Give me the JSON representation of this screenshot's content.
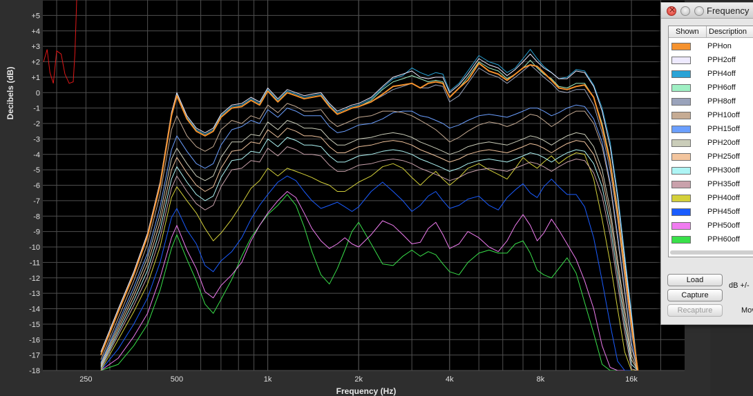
{
  "window": {
    "title": "Frequency",
    "table_headers": {
      "shown": "Shown",
      "description": "Description"
    },
    "buttons": {
      "load": "Load",
      "capture": "Capture",
      "recapture": "Recapture"
    },
    "db_label": "dB +/-",
    "mo_label": "Mov"
  },
  "colors": {
    "background": "#000000",
    "grid": "#505050",
    "frame": "#2e2e2e",
    "axis_text": "#e0e0e0"
  },
  "chart_data": {
    "type": "line",
    "title": "",
    "xlabel": "Frequency (Hz)",
    "ylabel": "Decibels (dB)",
    "xscale": "log",
    "xlim": [
      180,
      24000
    ],
    "ylim": [
      -18,
      6
    ],
    "grid": true,
    "legend": "side panel",
    "x_ticks": [
      {
        "value": 250,
        "label": "250"
      },
      {
        "value": 500,
        "label": "500"
      },
      {
        "value": 1000,
        "label": "1k"
      },
      {
        "value": 2000,
        "label": "2k"
      },
      {
        "value": 4000,
        "label": "4k"
      },
      {
        "value": 8000,
        "label": "8k"
      },
      {
        "value": 16000,
        "label": "16k"
      }
    ],
    "y_ticks": [
      {
        "value": 5,
        "label": "+5"
      },
      {
        "value": 4,
        "label": "+4"
      },
      {
        "value": 3,
        "label": "+3"
      },
      {
        "value": 2,
        "label": "+2"
      },
      {
        "value": 1,
        "label": "+1"
      },
      {
        "value": 0,
        "label": "0"
      },
      {
        "value": -1,
        "label": "-1"
      },
      {
        "value": -2,
        "label": "-2"
      },
      {
        "value": -3,
        "label": "-3"
      },
      {
        "value": -4,
        "label": "-4"
      },
      {
        "value": -5,
        "label": "-5"
      },
      {
        "value": -6,
        "label": "-6"
      },
      {
        "value": -7,
        "label": "-7"
      },
      {
        "value": -8,
        "label": "-8"
      },
      {
        "value": -9,
        "label": "-9"
      },
      {
        "value": -10,
        "label": "-10"
      },
      {
        "value": -11,
        "label": "-11"
      },
      {
        "value": -12,
        "label": "-12"
      },
      {
        "value": -13,
        "label": "-13"
      },
      {
        "value": -14,
        "label": "-14"
      },
      {
        "value": -15,
        "label": "-15"
      },
      {
        "value": -16,
        "label": "-16"
      },
      {
        "value": -17,
        "label": "-17"
      },
      {
        "value": -18,
        "label": "-18"
      }
    ],
    "x": [
      280,
      320,
      360,
      400,
      440,
      480,
      500,
      540,
      580,
      620,
      660,
      700,
      760,
      820,
      880,
      940,
      1000,
      1080,
      1160,
      1240,
      1320,
      1400,
      1500,
      1600,
      1700,
      1800,
      1900,
      2000,
      2200,
      2400,
      2600,
      2800,
      3000,
      3200,
      3400,
      3600,
      3800,
      4000,
      4300,
      4600,
      5000,
      5400,
      5800,
      6200,
      6600,
      7000,
      7400,
      7800,
      8200,
      8700,
      9200,
      9800,
      10500,
      11200,
      12000,
      12800,
      13600,
      14400,
      15200,
      16000,
      16800
    ],
    "series": [
      {
        "name": "PPHon",
        "color": "#f5922e",
        "values": [
          -17,
          -14.2,
          -11.8,
          -9.3,
          -6,
          -1.5,
          -0.2,
          -1.7,
          -2.5,
          -2.8,
          -2.5,
          -1.6,
          -1,
          -0.9,
          -0.5,
          -0.8,
          0.1,
          -0.6,
          0,
          -0.2,
          -0.4,
          -0.3,
          -0.2,
          -0.9,
          -1.4,
          -1.2,
          -1,
          -0.9,
          -0.6,
          -0.1,
          0.4,
          0.5,
          0.6,
          0.3,
          0.6,
          0.7,
          0.6,
          -0.3,
          0.3,
          0.8,
          1.9,
          1.4,
          1.2,
          0.8,
          1.2,
          1.6,
          1.8,
          1.7,
          1.3,
          0.8,
          0.3,
          0.2,
          0.4,
          0.5,
          -0.3,
          -2.2,
          -4.5,
          -7.8,
          -11.5,
          -15,
          -18
        ]
      },
      {
        "name": "PPH2off",
        "color": "#eeeaff",
        "values": [
          -16.8,
          -14,
          -11.6,
          -9.1,
          -5.8,
          -1.3,
          0,
          -1.5,
          -2.3,
          -2.6,
          -2.3,
          -1.4,
          -0.8,
          -0.7,
          -0.3,
          -0.6,
          0.3,
          -0.4,
          0.2,
          0,
          -0.2,
          -0.1,
          0,
          -0.7,
          -1.2,
          -1,
          -0.8,
          -0.7,
          -0.3,
          0.4,
          1,
          1.2,
          1.4,
          1,
          0.9,
          1,
          1,
          0,
          0.5,
          1.2,
          2.2,
          1.8,
          1.6,
          1.1,
          1.5,
          2,
          2.5,
          2,
          1.6,
          1.3,
          0.9,
          0.9,
          1.4,
          1.3,
          0.4,
          -1.2,
          -3.5,
          -6.8,
          -10.8,
          -14.5,
          -18
        ]
      },
      {
        "name": "PPH4off",
        "color": "#2aa3d6",
        "values": [
          -16.9,
          -14.1,
          -11.7,
          -9.2,
          -5.9,
          -1.4,
          -0.1,
          -1.6,
          -2.4,
          -2.7,
          -2.4,
          -1.5,
          -0.9,
          -0.8,
          -0.4,
          -0.7,
          0.2,
          -0.5,
          0.1,
          -0.1,
          -0.3,
          -0.2,
          -0.1,
          -0.8,
          -1.3,
          -1.1,
          -0.9,
          -0.8,
          -0.4,
          0.3,
          0.9,
          1.1,
          1.6,
          1.3,
          1.1,
          1.3,
          1.2,
          0.1,
          0.6,
          1.4,
          2.4,
          2,
          1.8,
          1.3,
          1.6,
          2.2,
          2.8,
          2.2,
          1.7,
          1.3,
          0.9,
          1,
          1.5,
          1.4,
          0.5,
          -1,
          -3.2,
          -6.5,
          -10.5,
          -14.2,
          -18
        ]
      },
      {
        "name": "PPH6off",
        "color": "#9ff0c4",
        "values": [
          -17,
          -14.2,
          -11.8,
          -9.3,
          -6,
          -1.5,
          -0.2,
          -1.7,
          -2.5,
          -2.8,
          -2.5,
          -1.6,
          -1,
          -0.9,
          -0.5,
          -0.8,
          0.1,
          -0.6,
          0,
          -0.2,
          -0.4,
          -0.3,
          -0.2,
          -0.9,
          -1.4,
          -1.2,
          -1,
          -0.9,
          -0.5,
          0.2,
          0.7,
          0.9,
          1.1,
          0.9,
          0.7,
          0.8,
          0.7,
          -0.3,
          0.3,
          1,
          2,
          1.6,
          1.4,
          0.9,
          1.2,
          1.6,
          2.1,
          1.6,
          1.2,
          0.9,
          0.4,
          0.3,
          0.6,
          0.6,
          -0.3,
          -2,
          -4.3,
          -7.5,
          -11.2,
          -14.8,
          -18
        ]
      },
      {
        "name": "PPH8off",
        "color": "#9aa3bb",
        "values": [
          -17,
          -14.2,
          -11.8,
          -9.3,
          -6,
          -1.5,
          -0.2,
          -1.7,
          -2.5,
          -2.8,
          -2.5,
          -1.6,
          -1,
          -0.9,
          -0.5,
          -0.8,
          0.1,
          -0.6,
          0,
          -0.2,
          -0.4,
          -0.3,
          -0.2,
          -0.9,
          -1.4,
          -1.2,
          -1,
          -0.9,
          -0.6,
          -0.2,
          0.2,
          0.4,
          0.6,
          0.3,
          0.3,
          0.5,
          0.4,
          -0.6,
          -0.2,
          0.6,
          1.6,
          1.2,
          1,
          0.6,
          1,
          1.4,
          1.8,
          1.4,
          1,
          0.6,
          0.1,
          0,
          0.2,
          0.2,
          -0.8,
          -2.6,
          -5,
          -8.2,
          -12,
          -15.5,
          -18
        ]
      },
      {
        "name": "PPH10off",
        "color": "#c6ab93",
        "values": [
          -17.3,
          -14.6,
          -12.2,
          -9.8,
          -6.6,
          -2.4,
          -1.5,
          -2.8,
          -3.5,
          -3.8,
          -3.5,
          -2.4,
          -1.8,
          -2,
          -1.5,
          -1.7,
          -0.8,
          -1.3,
          -0.7,
          -0.9,
          -1.2,
          -1.2,
          -1.1,
          -1.8,
          -2.2,
          -2,
          -1.8,
          -1.6,
          -1.5,
          -1.2,
          -1.2,
          -1.3,
          -1.5,
          -1.8,
          -2.1,
          -2.4,
          -2.8,
          -3.2,
          -2.9,
          -2.5,
          -2.1,
          -1.9,
          -2,
          -2.2,
          -2,
          -1.7,
          -1.4,
          -1.5,
          -1.8,
          -2.2,
          -1.9,
          -1.5,
          -1.2,
          -1.2,
          -2,
          -3.5,
          -6,
          -9.5,
          -13,
          -16.5,
          -18
        ]
      },
      {
        "name": "PPH15off",
        "color": "#6b9fff",
        "values": [
          -17.5,
          -14.9,
          -12.6,
          -10.4,
          -7.4,
          -3.7,
          -2.8,
          -3.8,
          -4.6,
          -4.9,
          -4.6,
          -3.4,
          -2.4,
          -2.2,
          -1.8,
          -2,
          -1.1,
          -1.6,
          -1,
          -1.2,
          -1.5,
          -1.5,
          -1.5,
          -2.2,
          -2.6,
          -2.5,
          -2.3,
          -2.1,
          -2,
          -1.7,
          -1.3,
          -1.2,
          -1.2,
          -1.5,
          -1.6,
          -1.8,
          -2,
          -2.3,
          -2.1,
          -1.8,
          -1.5,
          -1.4,
          -1.5,
          -1.6,
          -1.4,
          -1.2,
          -1,
          -1,
          -1.2,
          -1.5,
          -1.3,
          -1,
          -0.8,
          -0.9,
          -1.7,
          -3.2,
          -5.8,
          -9.2,
          -12.8,
          -16.2,
          -18
        ]
      },
      {
        "name": "PPH20off",
        "color": "#cacdb9",
        "values": [
          -17.6,
          -15.1,
          -12.9,
          -10.7,
          -7.9,
          -4.3,
          -3.6,
          -4.6,
          -5.4,
          -5.7,
          -5.4,
          -4.2,
          -3.2,
          -3.2,
          -2.7,
          -2.8,
          -1.9,
          -2.4,
          -1.8,
          -2,
          -2.3,
          -2.3,
          -2.4,
          -3,
          -3.4,
          -3.4,
          -3.2,
          -3,
          -2.9,
          -2.7,
          -2.6,
          -2.7,
          -2.9,
          -3.2,
          -3.4,
          -3.6,
          -3.8,
          -4,
          -3.8,
          -3.5,
          -3.3,
          -3.2,
          -3.3,
          -3.4,
          -3.2,
          -3,
          -2.8,
          -2.9,
          -3.1,
          -3.4,
          -3.1,
          -2.8,
          -2.6,
          -2.7,
          -3.5,
          -5,
          -7.5,
          -10.8,
          -14,
          -17,
          -18
        ]
      },
      {
        "name": "PPH25off",
        "color": "#f3c59e",
        "values": [
          -17.7,
          -15.3,
          -13.2,
          -11.1,
          -8.4,
          -5,
          -4.2,
          -5.2,
          -6,
          -6.4,
          -6.1,
          -4.9,
          -3.8,
          -3.7,
          -3.2,
          -3.3,
          -2.4,
          -2.9,
          -2.3,
          -2.5,
          -2.8,
          -2.8,
          -2.9,
          -3.5,
          -3.9,
          -3.9,
          -3.7,
          -3.5,
          -3.4,
          -3.2,
          -3.1,
          -3.2,
          -3.4,
          -3.7,
          -3.9,
          -4.1,
          -4.3,
          -4.5,
          -4.3,
          -4,
          -3.8,
          -3.7,
          -3.8,
          -3.9,
          -3.7,
          -3.5,
          -3.3,
          -3.4,
          -3.6,
          -3.9,
          -3.6,
          -3.3,
          -3.1,
          -3.2,
          -4,
          -5.5,
          -8,
          -11.2,
          -14.5,
          -17.3,
          -18
        ]
      },
      {
        "name": "PPH30off",
        "color": "#aef5f5",
        "values": [
          -17.8,
          -15.5,
          -13.5,
          -11.5,
          -8.9,
          -5.6,
          -4.8,
          -5.8,
          -6.6,
          -7,
          -6.7,
          -5.5,
          -4.4,
          -4.3,
          -3.8,
          -3.9,
          -3,
          -3.5,
          -2.9,
          -3.1,
          -3.4,
          -3.4,
          -3.5,
          -4.1,
          -4.5,
          -4.5,
          -4.3,
          -4.1,
          -4,
          -3.8,
          -3.7,
          -3.8,
          -4,
          -4.3,
          -4.5,
          -4.7,
          -4.9,
          -5.1,
          -4.9,
          -4.6,
          -4.4,
          -4.3,
          -4.4,
          -4.5,
          -4.3,
          -4.1,
          -3.9,
          -4,
          -4.2,
          -4.5,
          -4.2,
          -3.9,
          -3.7,
          -3.8,
          -4.6,
          -6.1,
          -8.6,
          -11.8,
          -15,
          -17.6,
          -18
        ]
      },
      {
        "name": "PPH35off",
        "color": "#c9a1ab",
        "values": [
          -17.9,
          -15.7,
          -13.8,
          -11.9,
          -9.4,
          -6.2,
          -5.4,
          -6.4,
          -7.2,
          -7.6,
          -7.3,
          -6.1,
          -5,
          -4.9,
          -4.4,
          -4.5,
          -3.6,
          -4.1,
          -3.5,
          -3.7,
          -4,
          -4,
          -4.1,
          -4.7,
          -5.1,
          -5.1,
          -4.9,
          -4.7,
          -4.6,
          -4.4,
          -4.3,
          -4.4,
          -4.6,
          -4.9,
          -5.1,
          -5.3,
          -5.5,
          -5.7,
          -5.5,
          -5.2,
          -5,
          -4.9,
          -5,
          -5.1,
          -4.9,
          -4.7,
          -4.5,
          -4.6,
          -4.8,
          -5.1,
          -4.8,
          -4.5,
          -4.3,
          -4.4,
          -5.2,
          -6.7,
          -9.2,
          -12.4,
          -15.5,
          -17.9,
          -18
        ]
      },
      {
        "name": "PPH40off",
        "color": "#d4d03a",
        "values": [
          -18,
          -16,
          -14.2,
          -12.4,
          -10,
          -6.8,
          -6.1,
          -7,
          -7.8,
          -8.8,
          -9.6,
          -9.1,
          -8.2,
          -7.2,
          -6.2,
          -5.7,
          -4.9,
          -5.4,
          -4.9,
          -5.1,
          -5.3,
          -5.5,
          -5.8,
          -6,
          -6.4,
          -6.4,
          -6.1,
          -5.8,
          -5.4,
          -4.8,
          -4.6,
          -4.9,
          -5.5,
          -6,
          -5.5,
          -5.1,
          -5.6,
          -6,
          -5.5,
          -4.9,
          -4.6,
          -5,
          -5.3,
          -5.6,
          -4.9,
          -4.2,
          -4.6,
          -4.9,
          -4.5,
          -4.1,
          -4.6,
          -4.2,
          -3.9,
          -4,
          -5.6,
          -8.2,
          -11,
          -14,
          -16.8,
          -18,
          -18
        ]
      },
      {
        "name": "PPH45off",
        "color": "#1a5cff",
        "values": [
          -18,
          -16.6,
          -15,
          -13.3,
          -11,
          -8.1,
          -7.5,
          -8.9,
          -9.8,
          -11.2,
          -11.6,
          -10.9,
          -10.3,
          -9.4,
          -8.2,
          -7.3,
          -6.6,
          -5.8,
          -5.4,
          -5.7,
          -6.4,
          -7,
          -7.5,
          -7.3,
          -7.1,
          -7.4,
          -7.7,
          -7.4,
          -6.4,
          -5.8,
          -6.4,
          -7,
          -7.7,
          -7.3,
          -6.7,
          -6.4,
          -7,
          -7.5,
          -7.3,
          -6.9,
          -6.7,
          -7.3,
          -7.6,
          -6.8,
          -6.3,
          -5.9,
          -6.5,
          -6.8,
          -6.1,
          -5.6,
          -6.1,
          -6.6,
          -6.6,
          -7.4,
          -9.4,
          -12.2,
          -15,
          -17.4,
          -18,
          -18,
          -18
        ]
      },
      {
        "name": "PPH50off",
        "color": "#f07cf0",
        "values": [
          -18,
          -17.2,
          -15.8,
          -14.3,
          -12,
          -9.4,
          -8.6,
          -10.2,
          -11.4,
          -12.9,
          -13.3,
          -12.5,
          -11.8,
          -11,
          -9.6,
          -8.6,
          -7.8,
          -7,
          -6.4,
          -6.8,
          -7.8,
          -8.8,
          -9.6,
          -10.1,
          -9.8,
          -9.4,
          -9.8,
          -10,
          -9.2,
          -8.3,
          -8.6,
          -9.2,
          -9.8,
          -9.7,
          -8.8,
          -8.4,
          -9.2,
          -10.1,
          -9.8,
          -9,
          -9.4,
          -10,
          -10.3,
          -9.6,
          -8.6,
          -7.9,
          -8.6,
          -9.6,
          -9.1,
          -8.2,
          -8.9,
          -9.8,
          -10.8,
          -12.2,
          -14,
          -16.4,
          -17.8,
          -18,
          -18,
          -18,
          -18
        ]
      },
      {
        "name": "PPH60off",
        "color": "#39e04a",
        "values": [
          -18,
          -17.6,
          -16.4,
          -15,
          -12.8,
          -10.1,
          -9.2,
          -10.8,
          -12.2,
          -13.7,
          -14.3,
          -13.4,
          -12.1,
          -10.6,
          -9.4,
          -8.6,
          -7.9,
          -7.3,
          -6.6,
          -7.3,
          -8.7,
          -10.3,
          -11.8,
          -12.4,
          -11.4,
          -10.2,
          -9,
          -8.4,
          -9.8,
          -11.1,
          -11.2,
          -10.6,
          -10.2,
          -10.6,
          -10.3,
          -10.5,
          -11.1,
          -11.6,
          -11.8,
          -11,
          -10.4,
          -10.2,
          -10.4,
          -10.4,
          -9.8,
          -9.6,
          -10.4,
          -11.5,
          -11.8,
          -12,
          -11.4,
          -10.7,
          -11.7,
          -13.6,
          -15.6,
          -17.6,
          -18,
          -18,
          -18,
          -18,
          -18
        ]
      }
    ],
    "extra_trace": {
      "color": "#e01818",
      "points": [
        [
          181,
          2
        ],
        [
          186,
          2.8
        ],
        [
          190,
          1.3
        ],
        [
          195,
          0.6
        ],
        [
          200,
          2.7
        ],
        [
          207,
          2.5
        ],
        [
          213,
          1.2
        ],
        [
          220,
          0.6
        ],
        [
          227,
          0.7
        ],
        [
          230,
          2.6
        ],
        [
          233,
          6
        ]
      ]
    }
  }
}
